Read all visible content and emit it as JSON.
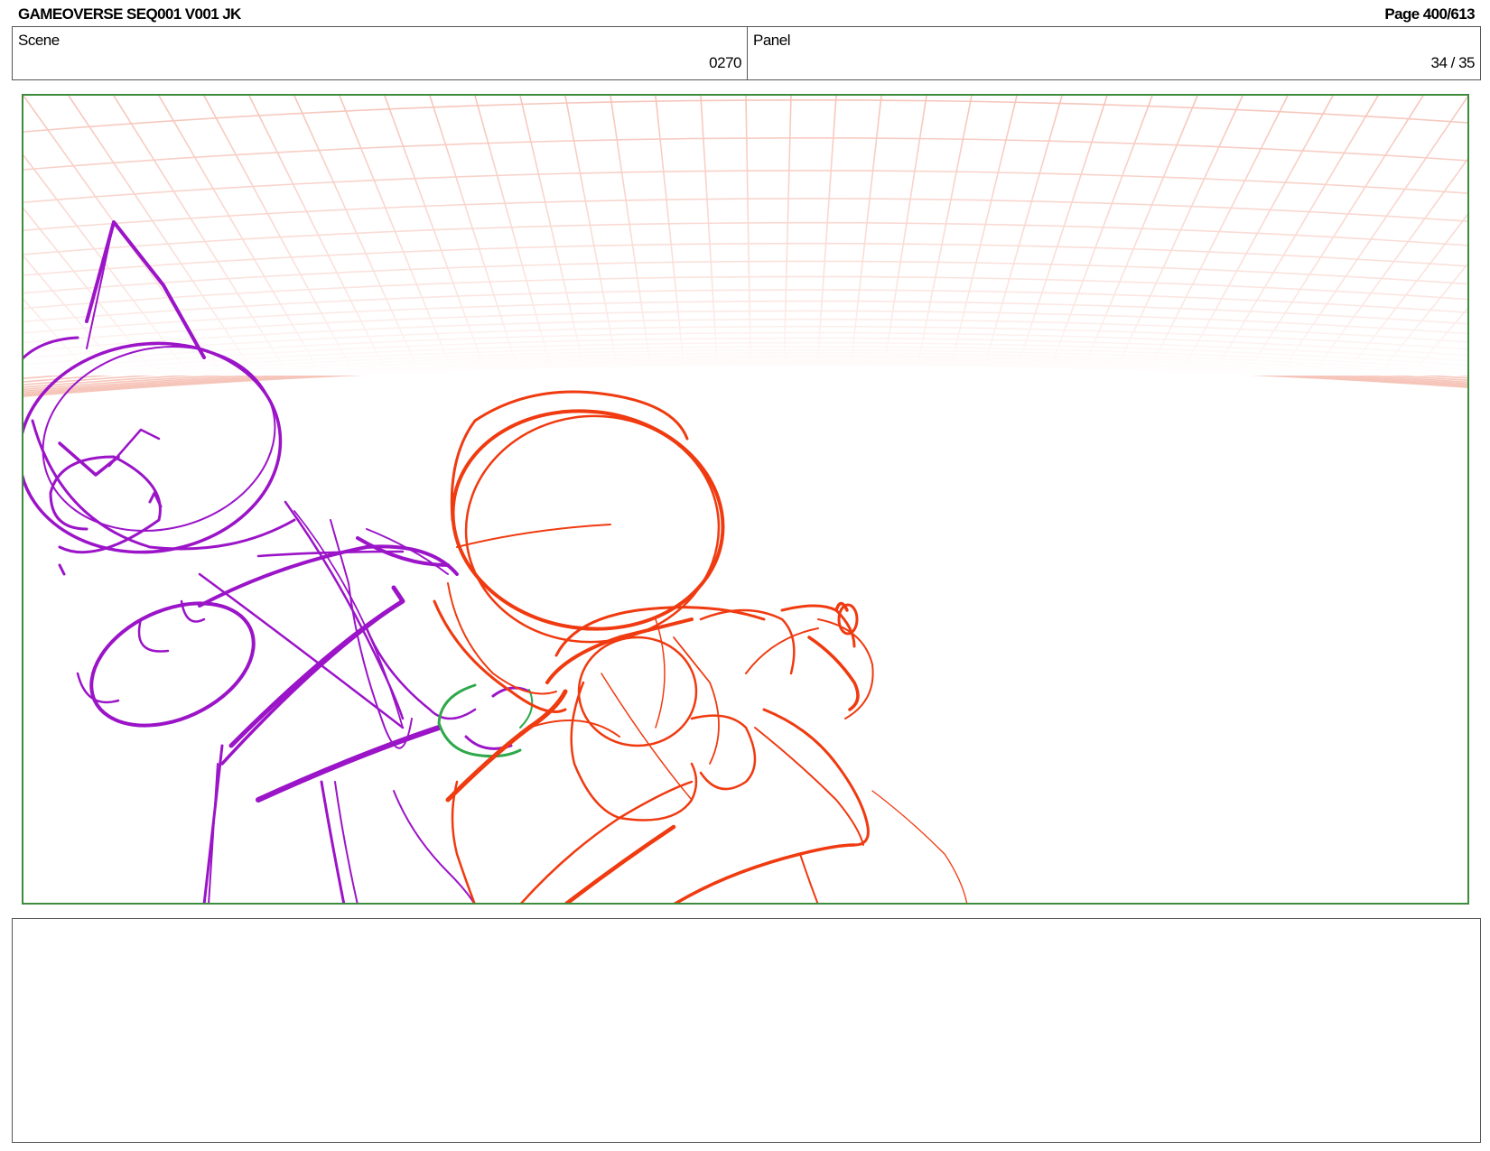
{
  "header": {
    "title": "GAMEOVERSE SEQ001 V001 JK",
    "page": "Page 400/613"
  },
  "info": {
    "scene_label": "Scene",
    "scene_value": "0270",
    "panel_label": "Panel",
    "panel_value": "34 / 35"
  },
  "drawing": {
    "grid_color": "#f4b2a4",
    "character_left_color": "#9b14c8",
    "character_right_color": "#f03a10",
    "accent_color": "#2ea84a",
    "frame_color": "#3c8c3c"
  },
  "notes": {
    "text": ""
  }
}
